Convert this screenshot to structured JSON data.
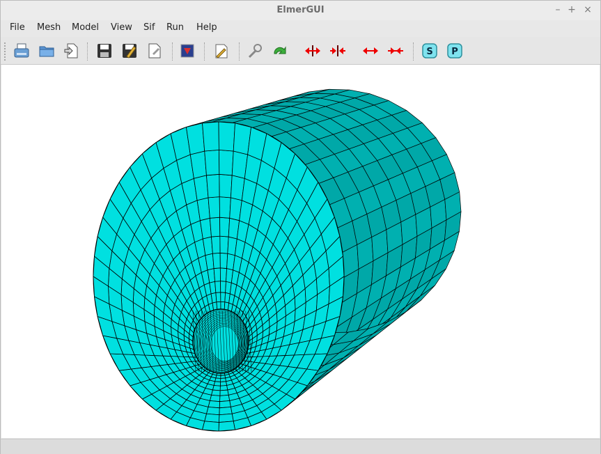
{
  "window": {
    "title": "ElmerGUI"
  },
  "window_controls": {
    "minimize": "–",
    "maximize": "+",
    "close": "×"
  },
  "menu": [
    "File",
    "Mesh",
    "Model",
    "View",
    "Sif",
    "Run",
    "Help"
  ],
  "toolbar": [
    {
      "icon": "open-file-icon"
    },
    {
      "icon": "open-folder-icon"
    },
    {
      "icon": "load-icon"
    },
    {
      "icon": "save-icon"
    },
    {
      "icon": "save-as-icon"
    },
    {
      "icon": "edit-document-icon"
    },
    {
      "icon": "color-image-icon"
    },
    {
      "icon": "pencil-icon"
    },
    {
      "icon": "wrench-icon"
    },
    {
      "icon": "redo-icon"
    },
    {
      "icon": "expand-arrows-icon"
    },
    {
      "icon": "compress-arrows-icon"
    },
    {
      "icon": "expand-horizontal-icon"
    },
    {
      "icon": "compress-horizontal-icon"
    },
    {
      "icon": "start-solver-icon",
      "label": "S"
    },
    {
      "icon": "postprocess-icon",
      "label": "P"
    }
  ],
  "colors": {
    "mesh_front": "#00e0e0",
    "mesh_side": "#00b0b0",
    "mesh_lines": "#000000"
  }
}
